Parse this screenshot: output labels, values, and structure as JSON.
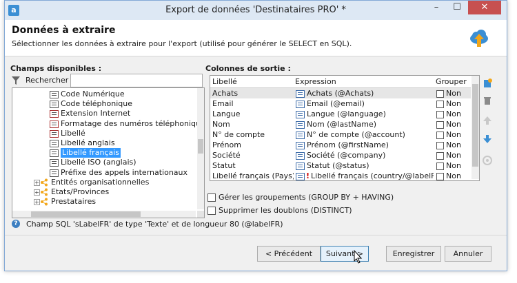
{
  "window": {
    "title": "Export de données 'Destinataires PRO' *",
    "controls": {
      "minimize": "–",
      "maximize": "☐",
      "close": "✕"
    }
  },
  "header": {
    "title": "Données à extraire",
    "subtitle": "Sélectionner les données à extraire pour l'export (utilisé pour générer le SELECT en SQL)."
  },
  "left_panel": {
    "label": "Champs disponibles :",
    "search_label": "Rechercher :",
    "search_value": "",
    "tree": [
      {
        "label": "Code Numérique",
        "icon": "field-icon",
        "level": 1
      },
      {
        "label": "Code téléphonique",
        "icon": "field-icon",
        "level": 1
      },
      {
        "label": "Extension Internet",
        "icon": "field-edit-icon",
        "level": 1
      },
      {
        "label": "Formatage des numéros téléphoniques  (!)",
        "icon": "field-edit-icon",
        "level": 1
      },
      {
        "label": "Libellé",
        "icon": "field-edit-icon",
        "level": 1
      },
      {
        "label": "Libellé anglais",
        "icon": "field-icon",
        "level": 1
      },
      {
        "label": "Libellé français",
        "icon": "field-icon",
        "level": 1,
        "selected": true
      },
      {
        "label": "Libellé ISO (anglais)",
        "icon": "field-icon",
        "level": 1
      },
      {
        "label": "Préfixe des appels internationaux",
        "icon": "field-icon",
        "level": 1
      },
      {
        "label": "Entités organisationnelles",
        "icon": "link-icon",
        "level": 0,
        "expander": "+"
      },
      {
        "label": "Etats/Provinces",
        "icon": "link-icon",
        "level": 0,
        "expander": "+"
      },
      {
        "label": "Prestataires",
        "icon": "link-icon",
        "level": 0,
        "expander": "+"
      }
    ],
    "vscroll_thumb": {
      "position": 0.42,
      "size": 0.12
    },
    "hscroll_thumb": {
      "position": 0.1,
      "size": 0.6
    }
  },
  "right_panel": {
    "label": "Colonnes de sortie :",
    "headers": {
      "libelle": "Libellé",
      "expression": "Expression",
      "grouper": "Grouper"
    },
    "rows": [
      {
        "libelle": "Achats",
        "expression": "Achats (@Achats)",
        "grouper": "Non",
        "selected": true
      },
      {
        "libelle": "Email",
        "expression": "Email (@email)",
        "grouper": "Non"
      },
      {
        "libelle": "Langue",
        "expression": "Langue (@language)",
        "grouper": "Non"
      },
      {
        "libelle": "Nom",
        "expression": "Nom (@lastName)",
        "grouper": "Non"
      },
      {
        "libelle": "N° de compte",
        "expression": "N° de compte (@account)",
        "grouper": "Non"
      },
      {
        "libelle": "Prénom",
        "expression": "Prénom (@firstName)",
        "grouper": "Non"
      },
      {
        "libelle": "Société",
        "expression": "Société (@company)",
        "grouper": "Non"
      },
      {
        "libelle": "Statut",
        "expression": "Statut (@status)",
        "grouper": "Non"
      },
      {
        "libelle": "Libellé français (Pays)",
        "expression": "Libellé français (country/@labelFR)",
        "grouper": "Non",
        "warning": true
      }
    ],
    "options": {
      "group_by": "Gérer les groupements (GROUP BY + HAVING)",
      "distinct": "Supprimer les doublons (DISTINCT)"
    },
    "side_buttons": [
      "add-column-icon",
      "delete-icon",
      "move-up-icon",
      "move-down-icon",
      "reset-icon"
    ]
  },
  "info": {
    "text": "Champ SQL 'sLabelFR' de type 'Texte' et de longueur 80 (@labelFR)"
  },
  "buttons": {
    "previous": "< Précédent",
    "next": "Suivant >",
    "save": "Enregistrer",
    "cancel": "Annuler"
  },
  "colors": {
    "selection": "#3399ff",
    "close_button": "#c75050",
    "accent": "#3b8fd4"
  }
}
